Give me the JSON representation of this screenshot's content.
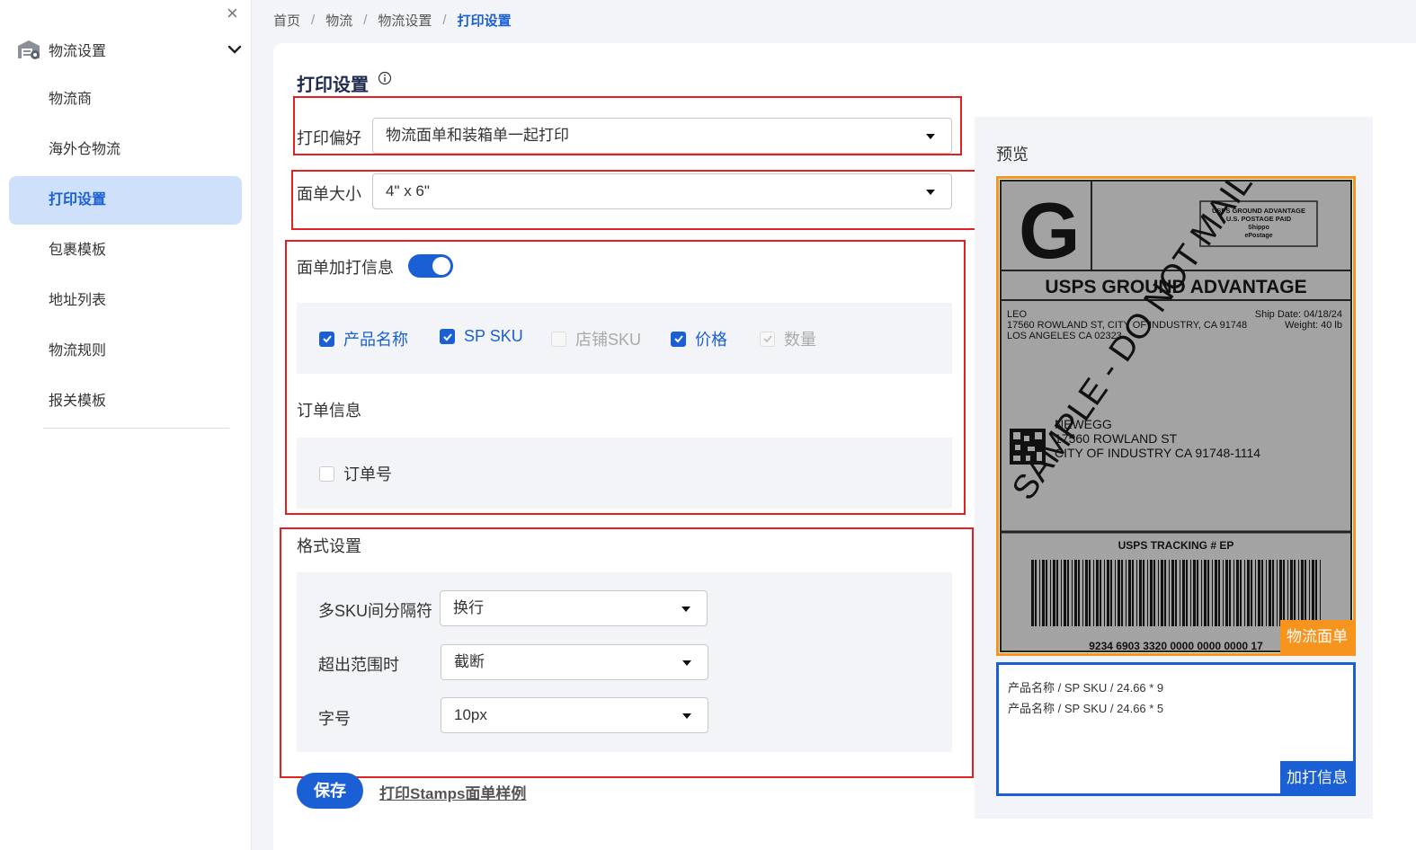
{
  "sidebar": {
    "group_label": "物流设置",
    "items": [
      {
        "label": "物流商"
      },
      {
        "label": "海外仓物流"
      },
      {
        "label": "打印设置"
      },
      {
        "label": "包裹模板"
      },
      {
        "label": "地址列表"
      },
      {
        "label": "物流规则"
      },
      {
        "label": "报关模板"
      }
    ],
    "active_index": 2
  },
  "breadcrumb": [
    "首页",
    "物流",
    "物流设置",
    "打印设置"
  ],
  "page_title": "打印设置",
  "print_preference": {
    "label": "打印偏好",
    "value": "物流面单和装箱单一起打印"
  },
  "label_size": {
    "label": "面单大小",
    "value": "4\" x 6\""
  },
  "extra_info": {
    "label": "面单加打信息",
    "enabled": true,
    "options": [
      {
        "label": "产品名称",
        "state": "checked"
      },
      {
        "label": "SP SKU",
        "state": "checked"
      },
      {
        "label": "店铺SKU",
        "state": "disabled-unchecked"
      },
      {
        "label": "价格",
        "state": "checked"
      },
      {
        "label": "数量",
        "state": "disabled-checked"
      }
    ]
  },
  "order_info": {
    "label": "订单信息",
    "options": [
      {
        "label": "订单号",
        "state": "unchecked"
      }
    ]
  },
  "format": {
    "label": "格式设置",
    "fields": [
      {
        "label": "多SKU间分隔符",
        "value": "换行"
      },
      {
        "label": "超出范围时",
        "value": "截断"
      },
      {
        "label": "字号",
        "value": "10px"
      }
    ]
  },
  "actions": {
    "save": "保存",
    "sample_link": "打印Stamps面单样例"
  },
  "preview": {
    "title": "预览",
    "label_tag": "物流面单",
    "extra_tag": "加打信息",
    "extra_lines": [
      "产品名称 / SP SKU / 24.66 * 9",
      "产品名称 / SP SKU / 24.66 * 5"
    ],
    "shipping_label": {
      "letter": "G",
      "postage_box": [
        "USPS GROUND ADVANTAGE",
        "U.S. POSTAGE PAID",
        "Shippo",
        "ePostage"
      ],
      "service": "USPS GROUND ADVANTAGE",
      "from_lines": [
        "LEO",
        "17560 ROWLAND ST, CITY OF INDUSTRY, CA 91748",
        "LOS ANGELES CA 02323"
      ],
      "ship_date": "Ship Date: 04/18/24",
      "weight": "Weight: 40 lb",
      "to_lines": [
        "NEWEGG",
        "17560 ROWLAND ST",
        "CITY OF INDUSTRY CA 91748-1114"
      ],
      "watermark": "SAMPLE - DO NOT MAIL",
      "tracking_title": "USPS TRACKING # EP",
      "tracking_number": "9234 6903 3320 0000 0000 0000 17"
    }
  },
  "colors": {
    "accent": "#1a5fd4",
    "highlight_box": "#e32020",
    "label_frame": "#f7941d"
  }
}
